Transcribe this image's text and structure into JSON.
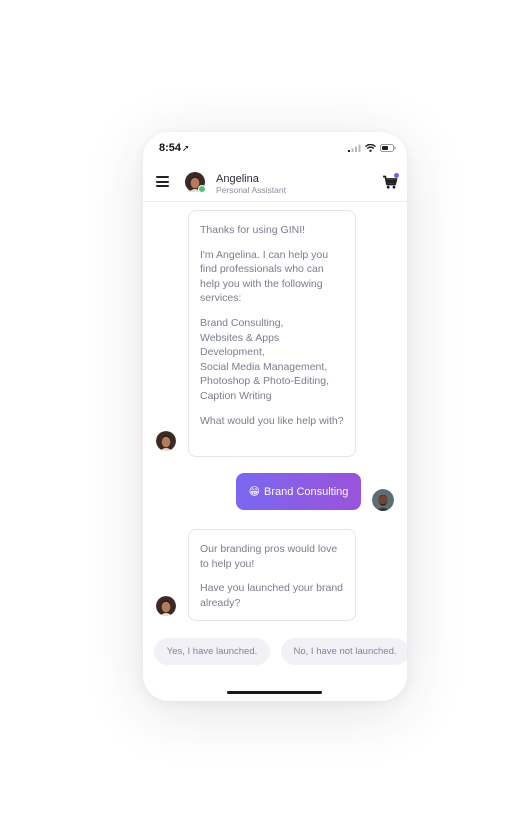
{
  "status_bar": {
    "time": "8:54"
  },
  "header": {
    "agent_name": "Angelina",
    "agent_role": "Personal Assistant"
  },
  "messages": {
    "bot_1": [
      "Thanks for using GINI!",
      "I'm Angelina. I can help you find professionals who can help you with the following services:",
      "Brand Consulting,\nWebsites & Apps Development,\nSocial Media Management,\nPhotoshop & Photo-Editing,\nCaption Writing",
      "What would you like help with?"
    ],
    "user_1": {
      "emoji": "😁",
      "text": "Brand Consulting"
    },
    "bot_2": [
      "Our branding pros would love to help you!",
      "Have you launched your brand already?"
    ]
  },
  "quick_replies": [
    "Yes, I have launched.",
    "No, I have not launched."
  ],
  "colors": {
    "accent_start": "#7a68f0",
    "accent_end": "#9b52dc",
    "online": "#4cc56e",
    "cart_badge": "#7b5ce6"
  }
}
